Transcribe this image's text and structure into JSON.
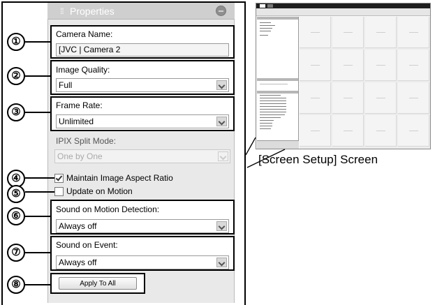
{
  "panel": {
    "title": "Properties",
    "camera_name_label": "Camera Name:",
    "camera_name_value": "[JVC | Camera 2",
    "image_quality_label": "Image Quality:",
    "image_quality_value": "Full",
    "frame_rate_label": "Frame Rate:",
    "frame_rate_value": "Unlimited",
    "ipix_split_label": "IPIX Split Mode:",
    "ipix_split_value": "One by One",
    "maintain_aspect_label": "Maintain Image Aspect Ratio",
    "maintain_aspect_checked": true,
    "update_on_motion_label": "Update on Motion",
    "update_on_motion_checked": false,
    "sound_motion_label": "Sound on Motion Detection:",
    "sound_motion_value": "Always off",
    "sound_event_label": "Sound on Event:",
    "sound_event_value": "Always off",
    "apply_button_label": "Apply To All"
  },
  "callouts": [
    "①",
    "②",
    "③",
    "④",
    "⑤",
    "⑥",
    "⑦",
    "⑧"
  ],
  "caption": "[Screen Setup] Screen",
  "icons": {
    "title_grip": "grip-icon",
    "title_button": "minimize-icon",
    "dropdown": "chevron-down-icon",
    "checkbox": "checkbox-icon"
  },
  "colors": {
    "panel_background": "#e9e9e9",
    "titlebar": "#cfcfcf",
    "callout_border": "#000000"
  }
}
